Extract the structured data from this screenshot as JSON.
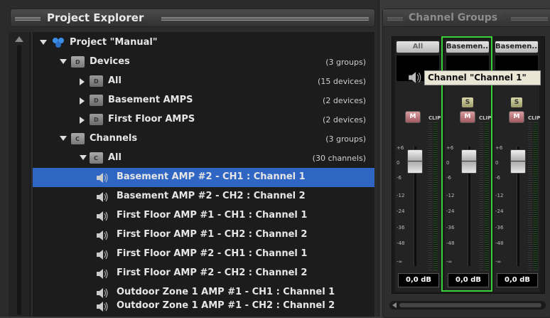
{
  "explorer": {
    "title": "Project Explorer",
    "rows": [
      {
        "label": "Project \"Manual\"",
        "count": "",
        "kind": "project"
      },
      {
        "label": "Devices",
        "count": "(3 groups)",
        "kind": "folder-open",
        "letter": "D"
      },
      {
        "label": "All",
        "count": "(15 devices)",
        "kind": "folder",
        "letter": "D"
      },
      {
        "label": "Basement AMPS",
        "count": "(2 devices)",
        "kind": "folder",
        "letter": "D"
      },
      {
        "label": "First Floor AMPS",
        "count": "(2 devices)",
        "kind": "folder",
        "letter": "D"
      },
      {
        "label": "Channels",
        "count": "(3 groups)",
        "kind": "folder-open",
        "letter": "C"
      },
      {
        "label": "All",
        "count": "(30 channels)",
        "kind": "folder-open",
        "letter": "C"
      },
      {
        "label": "Basement AMP #2 - CH1 : Channel 1",
        "count": "",
        "kind": "speaker",
        "selected": true
      },
      {
        "label": "Basement AMP #2 - CH2 : Channel 2",
        "count": "",
        "kind": "speaker"
      },
      {
        "label": "First Floor AMP #1 - CH1 : Channel 1",
        "count": "",
        "kind": "speaker"
      },
      {
        "label": "First Floor AMP #1 - CH2 : Channel 2",
        "count": "",
        "kind": "speaker"
      },
      {
        "label": "First Floor AMP #2 - CH1 : Channel 1",
        "count": "",
        "kind": "speaker"
      },
      {
        "label": "First Floor AMP #2 - CH2 : Channel 2",
        "count": "",
        "kind": "speaker"
      },
      {
        "label": "Outdoor Zone 1 AMP #1 - CH1 : Channel 1",
        "count": "",
        "kind": "speaker"
      },
      {
        "label": "Outdoor Zone 1 AMP #1 - CH2 : Channel 2",
        "count": "",
        "kind": "speaker"
      }
    ]
  },
  "groups": {
    "title": "Channel Groups",
    "tooltip": "Channel \"Channel 1\"",
    "strips": [
      {
        "name": "All",
        "db": "0,0 dB",
        "has_solo": false
      },
      {
        "name": "Basemen...",
        "db": "0,0 dB",
        "has_solo": true
      },
      {
        "name": "Basemen...",
        "db": "0,0 dB",
        "has_solo": true
      }
    ],
    "solo_label": "S",
    "mute_label": "M",
    "clip_label": "CLIP",
    "scale": [
      "+6",
      "0",
      "-6",
      "-12",
      "-24",
      "-36",
      "-48",
      "-∞"
    ],
    "colors": {
      "selection": "#2f66c4",
      "group_outline": "#3bd13b"
    }
  }
}
